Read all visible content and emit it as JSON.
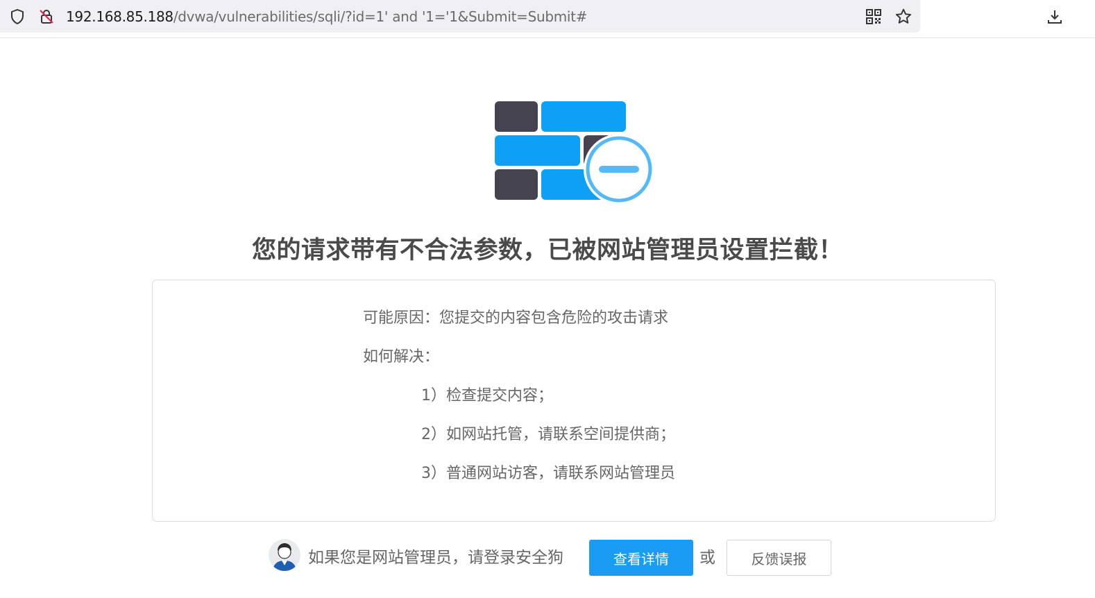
{
  "browser": {
    "url_host": "192.168.85.188",
    "url_rest": "/dvwa/vulnerabilities/sqli/?id=1' and '1='1&Submit=Submit#",
    "icons": [
      "shield-icon",
      "insecure-lock-icon",
      "qr-code-icon",
      "bookmark-star-icon",
      "download-icon"
    ]
  },
  "page": {
    "logo_icon": "firewall-block-icon",
    "headline": "您的请求带有不合法参数，已被网站管理员设置拦截！",
    "reason": "可能原因：您提交的内容包含危险的攻击请求",
    "how_to_fix_label": "如何解决：",
    "steps": [
      "1）检查提交内容；",
      "2）如网站托管，请联系空间提供商；",
      "3）普通网站访客，请联系网站管理员"
    ],
    "admin_prompt": "如果您是网站管理员，请登录安全狗",
    "details_button": "查看详情",
    "or_text": "或",
    "feedback_button": "反馈误报"
  },
  "colors": {
    "accent": "#1a9cf4",
    "brick_dark": "#45434f",
    "brick_blue": "#0ea0f5"
  }
}
